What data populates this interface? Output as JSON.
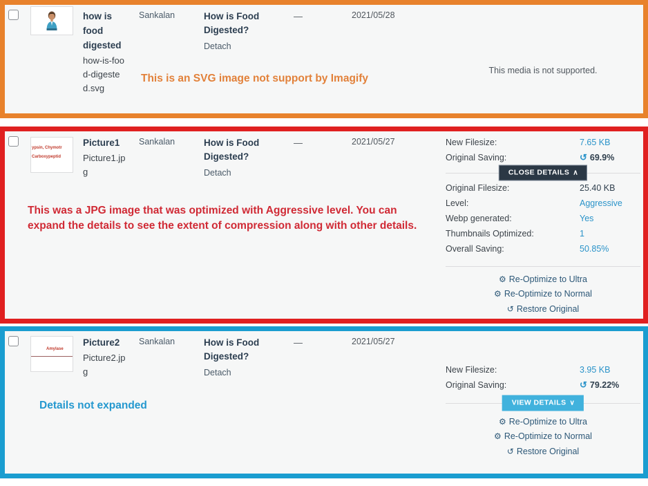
{
  "rows": [
    {
      "id": "row-svg",
      "border_color": "#e8822c",
      "checkbox_name": "select-row-checkbox",
      "thumbnail": {
        "icon": "person-avatar-thumbnail",
        "alt": "how-is-food-digested svg thumbnail"
      },
      "title": "how is food digested",
      "filename": "how-is-food-digested.svg",
      "author": "Sankalan",
      "parent": "How is Food Digested?",
      "detach": "Detach",
      "comments": "—",
      "date": "2021/05/28",
      "imagify": {
        "unsupported_text": "This media is not supported."
      },
      "annotation": "This is an SVG image not support by Imagify",
      "annotation_color": "#e2813a"
    },
    {
      "id": "row-picture1",
      "border_color": "#e02020",
      "checkbox_name": "select-row-checkbox",
      "thumbnail": {
        "icon": "text-image-thumbnail",
        "line1": "ypsin, Chymotr",
        "line2": "Carboxypeptid"
      },
      "title": "Picture1",
      "filename": "Picture1.jpg",
      "author": "Sankalan",
      "parent": "How is Food Digested?",
      "detach": "Detach",
      "comments": "—",
      "date": "2021/05/27",
      "imagify": {
        "summary": [
          {
            "label": "New Filesize:",
            "value": "7.65 KB",
            "style": "link"
          },
          {
            "label": "Original Saving:",
            "value": "69.9%",
            "style": "bold",
            "icon": "saving-spinner-icon"
          }
        ],
        "toggle_label": "CLOSE DETAILS",
        "toggle_caret": "∧",
        "toggle_state": "expanded",
        "details": [
          {
            "label": "Original Filesize:",
            "value": "25.40 KB",
            "style": "dark"
          },
          {
            "label": "Level:",
            "value": "Aggressive",
            "style": "link"
          },
          {
            "label": "Webp generated:",
            "value": "Yes",
            "style": "link"
          },
          {
            "label": "Thumbnails Optimized:",
            "value": "1",
            "style": "link"
          },
          {
            "label": "Overall Saving:",
            "value": "50.85%",
            "style": "link"
          }
        ],
        "actions": [
          {
            "icon": "gear-icon",
            "label": "Re-Optimize to Ultra"
          },
          {
            "icon": "gear-icon",
            "label": "Re-Optimize to Normal"
          },
          {
            "icon": "restore-icon",
            "label": "Restore Original"
          }
        ]
      },
      "annotation": "This was a JPG image that was optimized with Aggressive level. You can expand the details to see the extent of compression along with other details.",
      "annotation_color": "#d02a35"
    },
    {
      "id": "row-picture2",
      "border_color": "#1a9dd0",
      "checkbox_name": "select-row-checkbox",
      "thumbnail": {
        "icon": "text-image-thumbnail",
        "line1": "Amylase"
      },
      "title": "Picture2",
      "filename": "Picture2.jpg",
      "author": "Sankalan",
      "parent": "How is Food Digested?",
      "detach": "Detach",
      "comments": "—",
      "date": "2021/05/27",
      "imagify": {
        "summary": [
          {
            "label": "New Filesize:",
            "value": "3.95 KB",
            "style": "link"
          },
          {
            "label": "Original Saving:",
            "value": "79.22%",
            "style": "bold",
            "icon": "saving-spinner-icon"
          }
        ],
        "toggle_label": "VIEW DETAILS",
        "toggle_caret": "∨",
        "toggle_state": "collapsed",
        "actions": [
          {
            "icon": "gear-icon",
            "label": "Re-Optimize to Ultra"
          },
          {
            "icon": "gear-icon",
            "label": "Re-Optimize to Normal"
          },
          {
            "icon": "restore-icon",
            "label": "Restore Original"
          }
        ]
      },
      "annotation": "Details not expanded",
      "annotation_color": "#2498cf"
    }
  ],
  "glyphs": {
    "gear": "⚙",
    "restore": "↺",
    "spinner": "↻"
  }
}
